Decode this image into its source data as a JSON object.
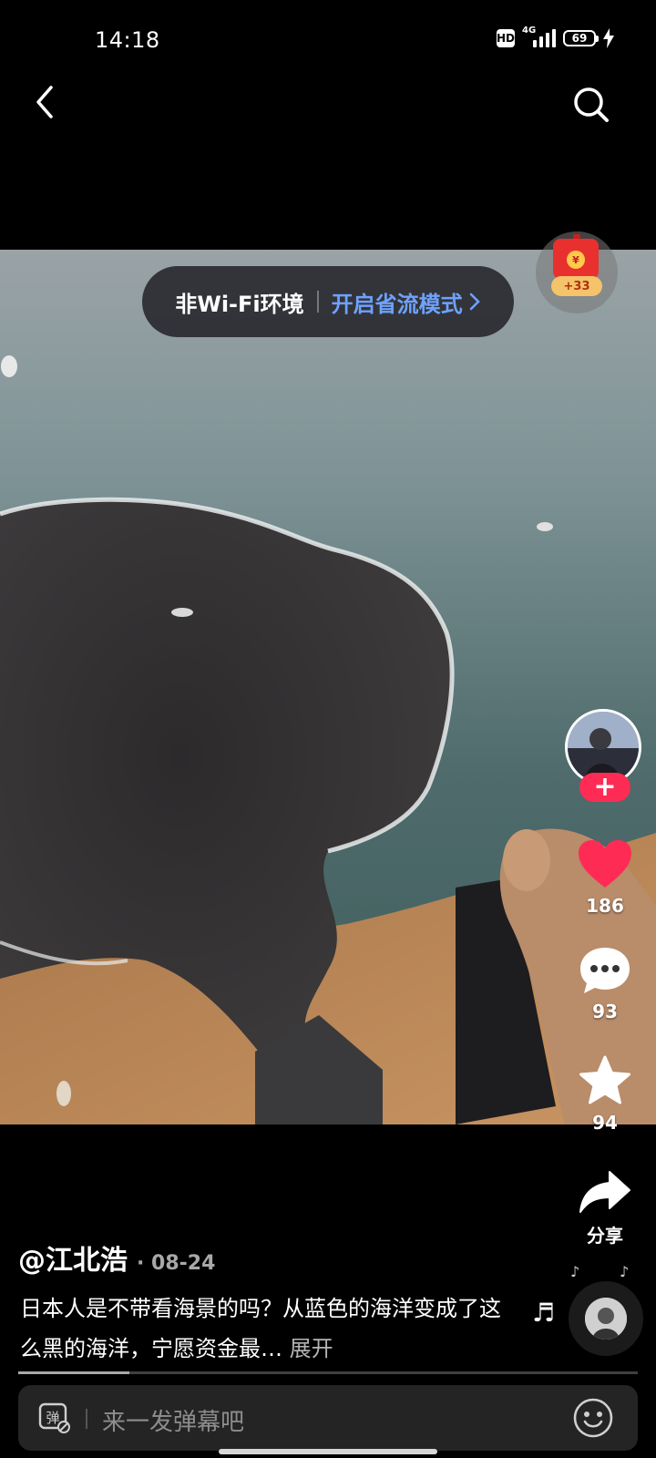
{
  "status_bar": {
    "time": "14:18",
    "hd": "HD",
    "network": "4G",
    "battery": "69"
  },
  "nav": {
    "back_icon": "chevron-left-icon",
    "search_icon": "search-icon"
  },
  "banner": {
    "env_label": "非Wi-Fi环境",
    "action_label": "开启省流模式"
  },
  "reward": {
    "bonus": "+33",
    "icon": "red-packet-icon"
  },
  "actions": {
    "likes": "186",
    "comments": "93",
    "favorites": "94",
    "share_label": "分享",
    "follow_symbol": "+"
  },
  "post": {
    "author": "@江北浩",
    "date": "08-24",
    "caption": "日本人是不带看海景的吗？从蓝色的海洋变成了这么黑的海洋，宁愿资金最…",
    "expand_label": "展开"
  },
  "playback": {
    "progress": 0.18
  },
  "danmaku": {
    "icon_text": "弹",
    "placeholder": "来一发弹幕吧"
  },
  "colors": {
    "like": "#fe2c55",
    "link": "#6ea2ff",
    "follow": "#fe2c55"
  }
}
